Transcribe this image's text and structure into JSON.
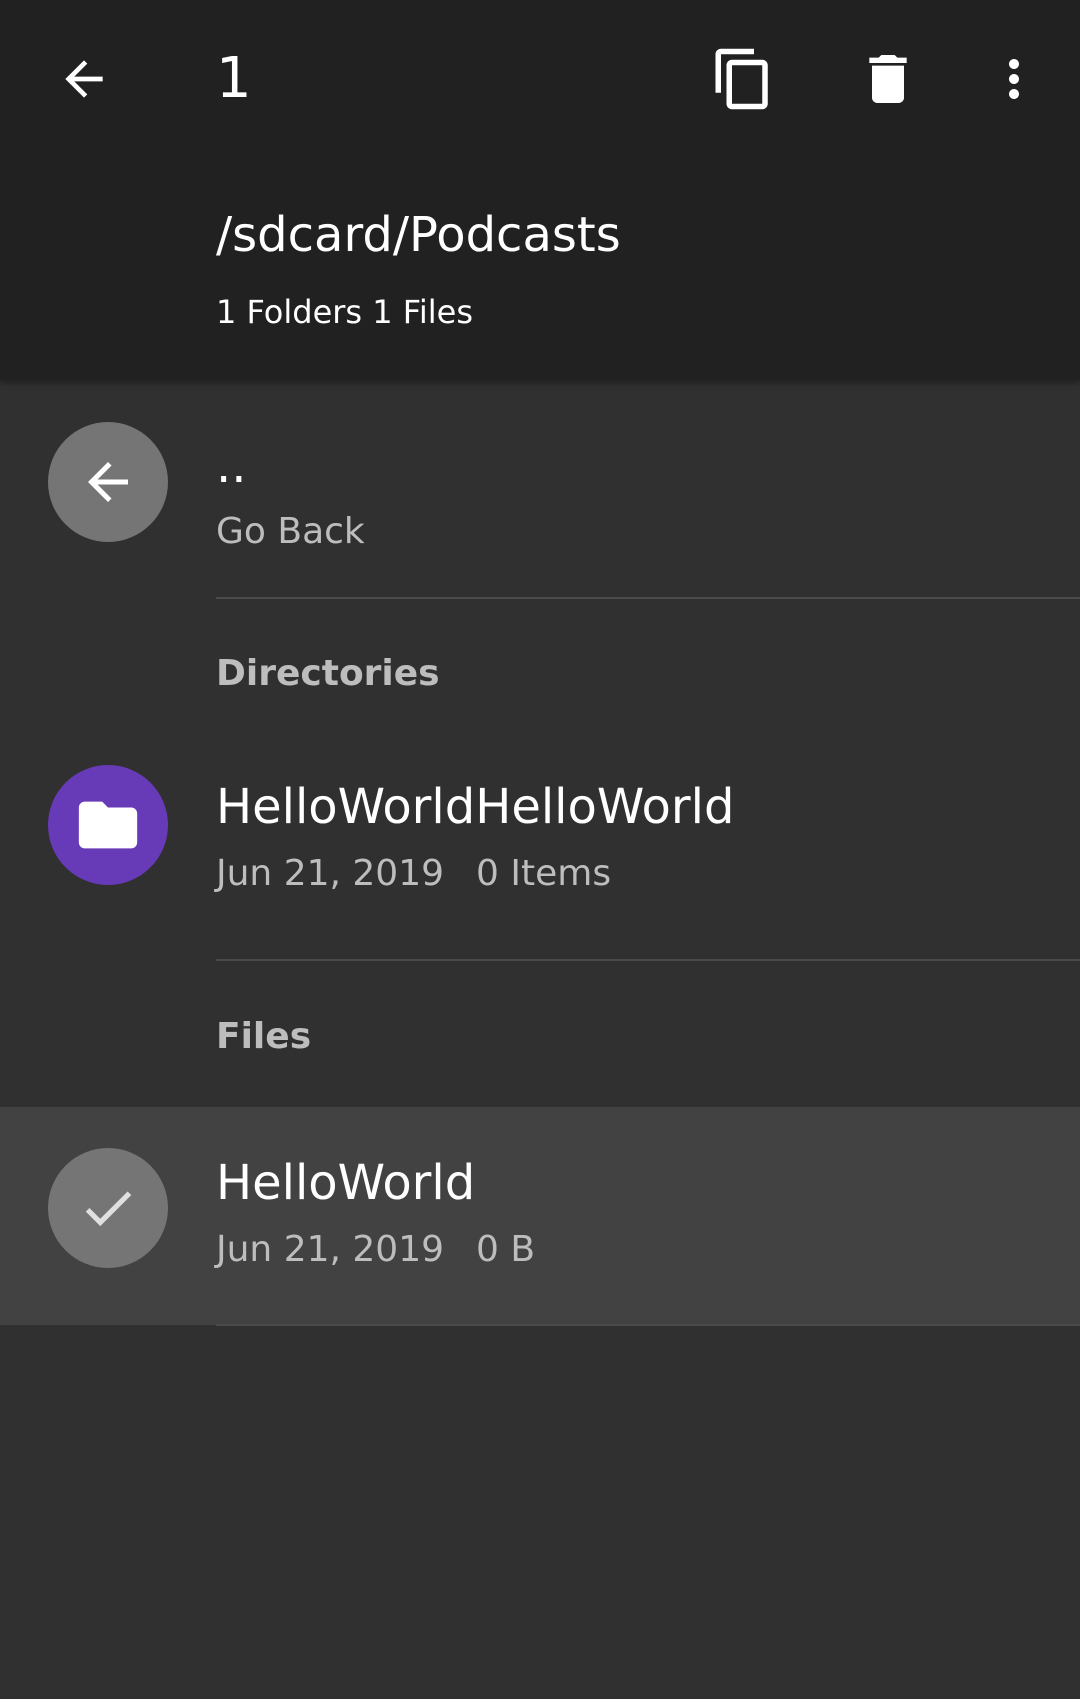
{
  "appbar": {
    "selection_count": "1",
    "path": "/sdcard/Podcasts",
    "summary": "1 Folders 1 Files",
    "actions": [
      "back-arrow-icon",
      "copy-icon",
      "delete-icon",
      "more-vert-icon"
    ]
  },
  "go_back": {
    "name": "..",
    "label": "Go Back",
    "icon": "arrow-back-icon"
  },
  "sections": {
    "directories": "Directories",
    "files": "Files"
  },
  "directories": [
    {
      "name": "HelloWorldHelloWorld",
      "date": "Jun 21, 2019",
      "detail": "0 Items",
      "icon": "folder-icon",
      "avatar_color": "#673ab7"
    }
  ],
  "files": [
    {
      "name": "HelloWorld",
      "date": "Jun 21, 2019",
      "detail": "0 B",
      "icon": "check-icon",
      "selected": true,
      "avatar_color": "#757575"
    }
  ],
  "colors": {
    "appbar": "#212121",
    "background": "#303030",
    "selected_row": "#424242",
    "folder_avatar": "#673ab7",
    "neutral_avatar": "#757575"
  }
}
